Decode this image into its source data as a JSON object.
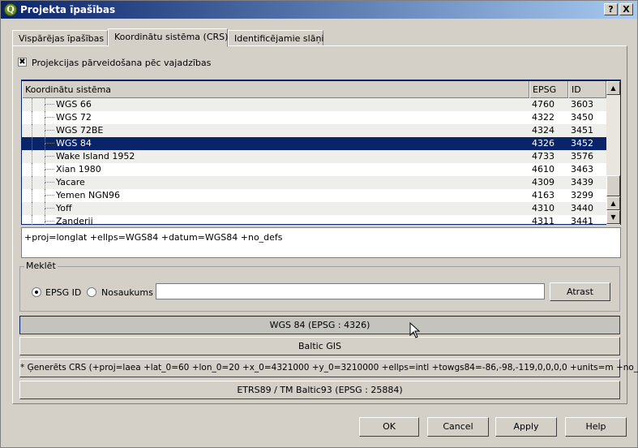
{
  "window": {
    "title": "Projekta īpašības",
    "app_icon": "qgis-icon",
    "help_button": "?",
    "close_button": "X"
  },
  "tabs": [
    {
      "label": "Vispārējas īpašības",
      "active": false
    },
    {
      "label": "Koordinātu sistēma (CRS)",
      "active": true
    },
    {
      "label": "Identificējamie slāņi",
      "active": false
    }
  ],
  "crs_tab": {
    "reprojection_checkbox": {
      "label": "Projekcijas pārveidošana pēc vajadzības",
      "checked": true
    },
    "tree": {
      "columns": [
        "Koordinātu sistēma",
        "EPSG",
        "ID"
      ],
      "rows": [
        {
          "name": "WGS 66",
          "epsg": "4760",
          "id": "3603",
          "selected": false
        },
        {
          "name": "WGS 72",
          "epsg": "4322",
          "id": "3450",
          "selected": false
        },
        {
          "name": "WGS 72BE",
          "epsg": "4324",
          "id": "3451",
          "selected": false
        },
        {
          "name": "WGS 84",
          "epsg": "4326",
          "id": "3452",
          "selected": true
        },
        {
          "name": "Wake Island 1952",
          "epsg": "4733",
          "id": "3576",
          "selected": false
        },
        {
          "name": "Xian 1980",
          "epsg": "4610",
          "id": "3463",
          "selected": false
        },
        {
          "name": "Yacare",
          "epsg": "4309",
          "id": "3439",
          "selected": false
        },
        {
          "name": "Yemen NGN96",
          "epsg": "4163",
          "id": "3299",
          "selected": false
        },
        {
          "name": "Yoff",
          "epsg": "4310",
          "id": "3440",
          "selected": false
        },
        {
          "name": "Zanderij",
          "epsg": "4311",
          "id": "3441",
          "selected": false
        }
      ]
    },
    "proj_string": "+proj=longlat +ellps=WGS84 +datum=WGS84 +no_defs",
    "search": {
      "group_title": "Meklēt",
      "radio_epsg": "EPSG ID",
      "radio_name": "Nosaukums",
      "radio_selected": "EPSG ID",
      "input_value": "",
      "find_button": "Atrast"
    },
    "recent_crs": [
      "WGS 84 (EPSG : 4326)",
      "Baltic GIS",
      "* Ģenerēts CRS (+proj=laea +lat_0=60 +lon_0=20 +x_0=4321000 +y_0=3210000 +ellps=intl +towgs84=-86,-98,-119,0,0,0,0 +units=m +no_defs)",
      "ETRS89 / TM Baltic93 (EPSG : 25884)"
    ]
  },
  "footer": {
    "ok": "OK",
    "cancel": "Cancel",
    "apply": "Apply",
    "help": "Help"
  }
}
